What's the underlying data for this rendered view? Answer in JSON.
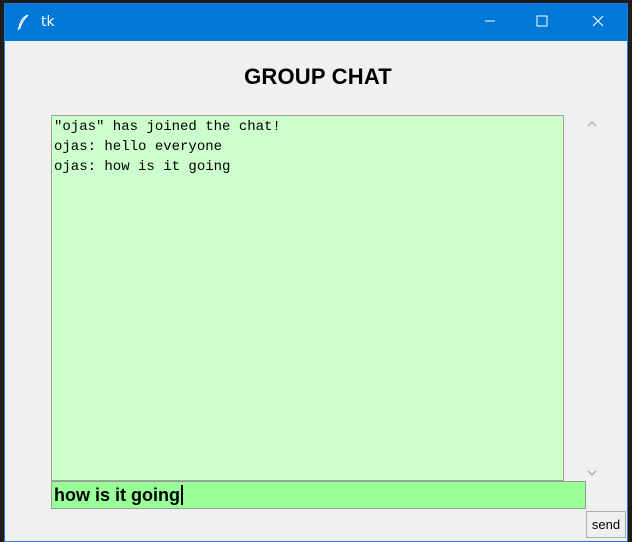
{
  "window": {
    "title": "tk"
  },
  "header": {
    "title": "GROUP CHAT"
  },
  "chat": {
    "messages": [
      "\"ojas\" has joined the chat!",
      "ojas: hello everyone",
      "ojas: how is it going"
    ]
  },
  "input": {
    "value": "how is it going"
  },
  "send": {
    "label": "send"
  },
  "icons": {
    "app": "feather-icon",
    "minimize": "minimize-icon",
    "maximize": "maximize-icon",
    "close": "close-icon",
    "scroll_up": "chevron-up-icon",
    "scroll_down": "chevron-down-icon"
  },
  "colors": {
    "titlebar": "#0078d7",
    "chat_background": "#ccffcc",
    "input_background": "#99ff99",
    "window_background": "#f0f0f0"
  }
}
